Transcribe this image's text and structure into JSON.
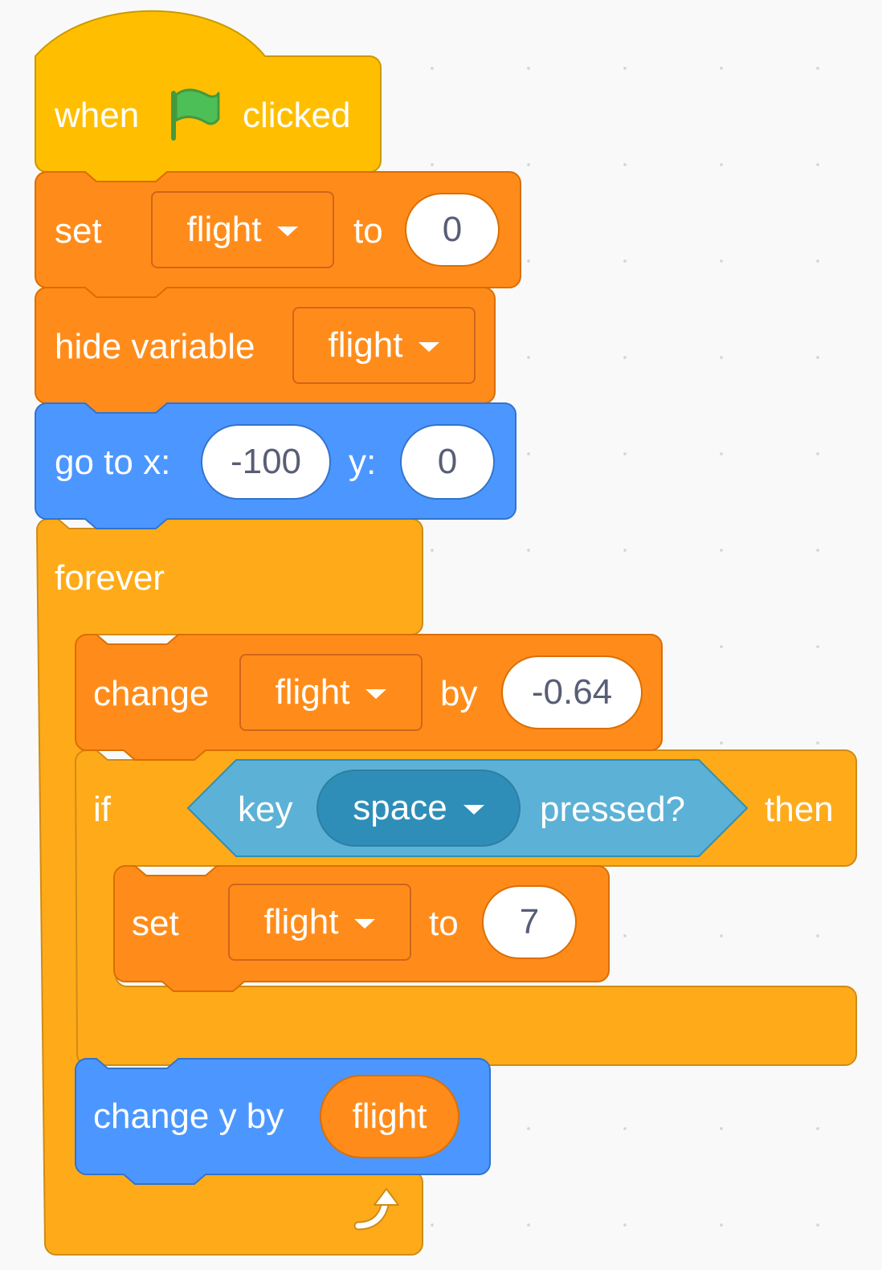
{
  "colors": {
    "events": "#ffbf00",
    "variables": "#ff8c1a",
    "motion": "#4c97ff",
    "control": "#ffab19",
    "sensing": "#5cb1d6",
    "workspace": "#f9f9f9",
    "flag_green": "#4cbf56",
    "input_text": "#575e75"
  },
  "hat_block": {
    "when_label": "when",
    "flag_icon": "green-flag-icon",
    "clicked_label": "clicked"
  },
  "set_block_1": {
    "label": "set",
    "variable": "flight",
    "to_label": "to",
    "value": "0"
  },
  "hide_variable_block": {
    "label": "hide variable",
    "variable": "flight"
  },
  "go_to_block": {
    "label": "go to x:",
    "x_value": "-100",
    "y_label": "y:",
    "y_value": "0"
  },
  "forever_block": {
    "label": "forever",
    "loop_icon": "loop-arrow-icon"
  },
  "change_block": {
    "label": "change",
    "variable": "flight",
    "by_label": "by",
    "value": "-0.64"
  },
  "if_block": {
    "label": "if",
    "then_label": "then",
    "condition": {
      "key_label": "key",
      "key_value": "space",
      "pressed_label": "pressed?"
    }
  },
  "set_block_2": {
    "label": "set",
    "variable": "flight",
    "to_label": "to",
    "value": "7"
  },
  "change_y_block": {
    "label": "change y by",
    "reporter": "flight"
  }
}
